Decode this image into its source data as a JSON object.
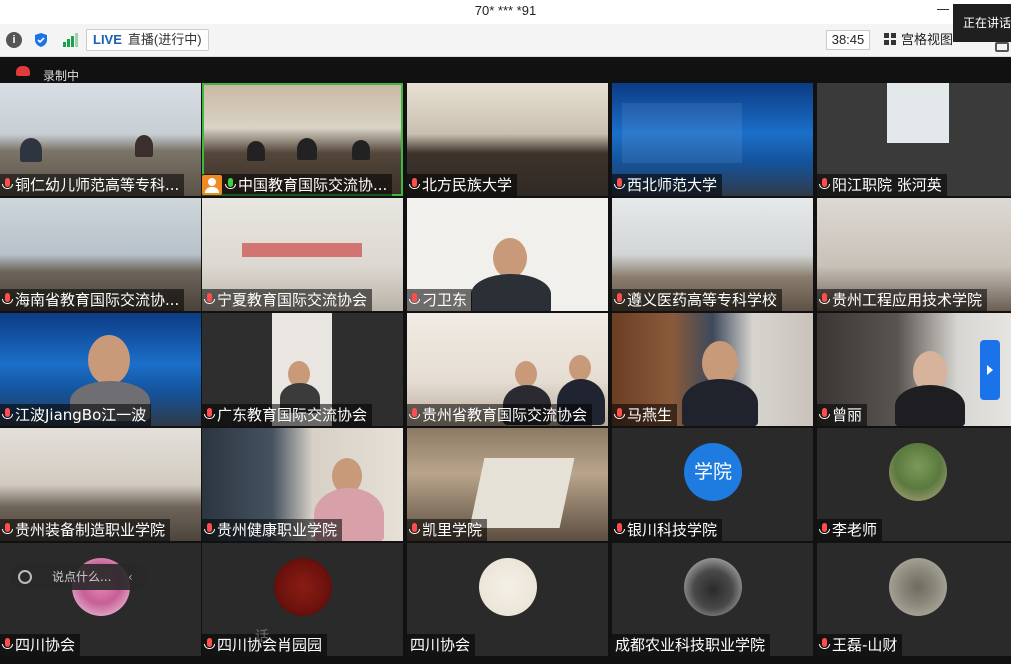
{
  "window": {
    "title": "70* *** *91",
    "speaking_label": "正在讲话"
  },
  "toolbar": {
    "live_label": "LIVE",
    "live_status": "直播(进行中)",
    "timer": "38:45",
    "gallery_view_label": "宫格视图"
  },
  "recording": {
    "label": "录制中"
  },
  "tiles": [
    {
      "name": "铜仁幼儿师范高等专科...",
      "mic": "muted-red"
    },
    {
      "name": "中国教育国际交流协...",
      "mic": "on",
      "badge": "user-icon"
    },
    {
      "name": "北方民族大学",
      "mic": "muted-red"
    },
    {
      "name": "西北师范大学",
      "mic": "muted-red"
    },
    {
      "name": "阳江职院 张河英",
      "mic": "muted-red"
    },
    {
      "name": "海南省教育国际交流协...",
      "mic": "muted-red"
    },
    {
      "name": "宁夏教育国际交流协会",
      "mic": "muted-red"
    },
    {
      "name": "刁卫东",
      "mic": "muted-red"
    },
    {
      "name": "遵义医药高等专科学校",
      "mic": "muted-red"
    },
    {
      "name": "贵州工程应用技术学院",
      "mic": "muted-red"
    },
    {
      "name": "江波JiangBo江一波",
      "mic": "muted-red"
    },
    {
      "name": "广东教育国际交流协会",
      "mic": "muted-red"
    },
    {
      "name": "贵州省教育国际交流协会",
      "mic": "muted-red"
    },
    {
      "name": "马燕生",
      "mic": "muted-red"
    },
    {
      "name": "曾丽",
      "mic": "muted-red"
    },
    {
      "name": "贵州装备制造职业学院",
      "mic": "muted-red"
    },
    {
      "name": "贵州健康职业学院",
      "mic": "muted-red"
    },
    {
      "name": "凯里学院",
      "mic": "muted-red"
    },
    {
      "name": "银川科技学院",
      "mic": "muted-red",
      "avatar_text": "学院"
    },
    {
      "name": "李老师",
      "mic": "muted-red"
    },
    {
      "name": "四川协会",
      "mic": "muted-red"
    },
    {
      "name": "四川协会肖园园",
      "mic": "muted-red"
    },
    {
      "name": "四川协会",
      "mic": "none"
    },
    {
      "name": "成都农业科技职业学院",
      "mic": "none"
    },
    {
      "name": "王磊-山财",
      "mic": "muted-red"
    }
  ],
  "chat": {
    "placeholder": "说点什么..."
  },
  "watermark": "话"
}
